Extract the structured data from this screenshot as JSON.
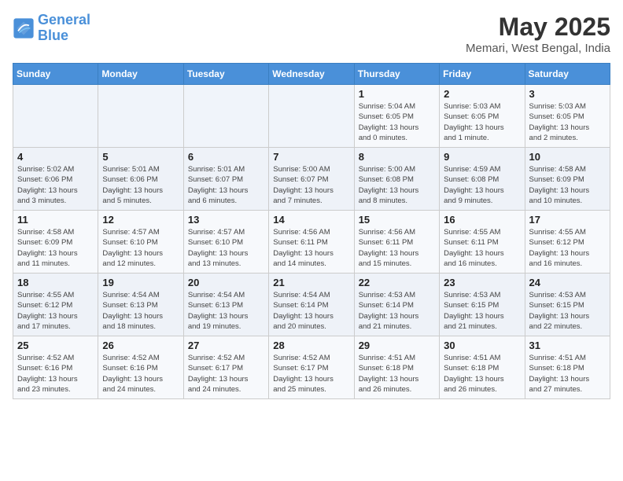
{
  "header": {
    "logo_line1": "General",
    "logo_line2": "Blue",
    "month": "May 2025",
    "location": "Memari, West Bengal, India"
  },
  "weekdays": [
    "Sunday",
    "Monday",
    "Tuesday",
    "Wednesday",
    "Thursday",
    "Friday",
    "Saturday"
  ],
  "weeks": [
    [
      {
        "day": "",
        "info": ""
      },
      {
        "day": "",
        "info": ""
      },
      {
        "day": "",
        "info": ""
      },
      {
        "day": "",
        "info": ""
      },
      {
        "day": "1",
        "info": "Sunrise: 5:04 AM\nSunset: 6:05 PM\nDaylight: 13 hours\nand 0 minutes."
      },
      {
        "day": "2",
        "info": "Sunrise: 5:03 AM\nSunset: 6:05 PM\nDaylight: 13 hours\nand 1 minute."
      },
      {
        "day": "3",
        "info": "Sunrise: 5:03 AM\nSunset: 6:05 PM\nDaylight: 13 hours\nand 2 minutes."
      }
    ],
    [
      {
        "day": "4",
        "info": "Sunrise: 5:02 AM\nSunset: 6:06 PM\nDaylight: 13 hours\nand 3 minutes."
      },
      {
        "day": "5",
        "info": "Sunrise: 5:01 AM\nSunset: 6:06 PM\nDaylight: 13 hours\nand 5 minutes."
      },
      {
        "day": "6",
        "info": "Sunrise: 5:01 AM\nSunset: 6:07 PM\nDaylight: 13 hours\nand 6 minutes."
      },
      {
        "day": "7",
        "info": "Sunrise: 5:00 AM\nSunset: 6:07 PM\nDaylight: 13 hours\nand 7 minutes."
      },
      {
        "day": "8",
        "info": "Sunrise: 5:00 AM\nSunset: 6:08 PM\nDaylight: 13 hours\nand 8 minutes."
      },
      {
        "day": "9",
        "info": "Sunrise: 4:59 AM\nSunset: 6:08 PM\nDaylight: 13 hours\nand 9 minutes."
      },
      {
        "day": "10",
        "info": "Sunrise: 4:58 AM\nSunset: 6:09 PM\nDaylight: 13 hours\nand 10 minutes."
      }
    ],
    [
      {
        "day": "11",
        "info": "Sunrise: 4:58 AM\nSunset: 6:09 PM\nDaylight: 13 hours\nand 11 minutes."
      },
      {
        "day": "12",
        "info": "Sunrise: 4:57 AM\nSunset: 6:10 PM\nDaylight: 13 hours\nand 12 minutes."
      },
      {
        "day": "13",
        "info": "Sunrise: 4:57 AM\nSunset: 6:10 PM\nDaylight: 13 hours\nand 13 minutes."
      },
      {
        "day": "14",
        "info": "Sunrise: 4:56 AM\nSunset: 6:11 PM\nDaylight: 13 hours\nand 14 minutes."
      },
      {
        "day": "15",
        "info": "Sunrise: 4:56 AM\nSunset: 6:11 PM\nDaylight: 13 hours\nand 15 minutes."
      },
      {
        "day": "16",
        "info": "Sunrise: 4:55 AM\nSunset: 6:11 PM\nDaylight: 13 hours\nand 16 minutes."
      },
      {
        "day": "17",
        "info": "Sunrise: 4:55 AM\nSunset: 6:12 PM\nDaylight: 13 hours\nand 16 minutes."
      }
    ],
    [
      {
        "day": "18",
        "info": "Sunrise: 4:55 AM\nSunset: 6:12 PM\nDaylight: 13 hours\nand 17 minutes."
      },
      {
        "day": "19",
        "info": "Sunrise: 4:54 AM\nSunset: 6:13 PM\nDaylight: 13 hours\nand 18 minutes."
      },
      {
        "day": "20",
        "info": "Sunrise: 4:54 AM\nSunset: 6:13 PM\nDaylight: 13 hours\nand 19 minutes."
      },
      {
        "day": "21",
        "info": "Sunrise: 4:54 AM\nSunset: 6:14 PM\nDaylight: 13 hours\nand 20 minutes."
      },
      {
        "day": "22",
        "info": "Sunrise: 4:53 AM\nSunset: 6:14 PM\nDaylight: 13 hours\nand 21 minutes."
      },
      {
        "day": "23",
        "info": "Sunrise: 4:53 AM\nSunset: 6:15 PM\nDaylight: 13 hours\nand 21 minutes."
      },
      {
        "day": "24",
        "info": "Sunrise: 4:53 AM\nSunset: 6:15 PM\nDaylight: 13 hours\nand 22 minutes."
      }
    ],
    [
      {
        "day": "25",
        "info": "Sunrise: 4:52 AM\nSunset: 6:16 PM\nDaylight: 13 hours\nand 23 minutes."
      },
      {
        "day": "26",
        "info": "Sunrise: 4:52 AM\nSunset: 6:16 PM\nDaylight: 13 hours\nand 24 minutes."
      },
      {
        "day": "27",
        "info": "Sunrise: 4:52 AM\nSunset: 6:17 PM\nDaylight: 13 hours\nand 24 minutes."
      },
      {
        "day": "28",
        "info": "Sunrise: 4:52 AM\nSunset: 6:17 PM\nDaylight: 13 hours\nand 25 minutes."
      },
      {
        "day": "29",
        "info": "Sunrise: 4:51 AM\nSunset: 6:18 PM\nDaylight: 13 hours\nand 26 minutes."
      },
      {
        "day": "30",
        "info": "Sunrise: 4:51 AM\nSunset: 6:18 PM\nDaylight: 13 hours\nand 26 minutes."
      },
      {
        "day": "31",
        "info": "Sunrise: 4:51 AM\nSunset: 6:18 PM\nDaylight: 13 hours\nand 27 minutes."
      }
    ]
  ]
}
